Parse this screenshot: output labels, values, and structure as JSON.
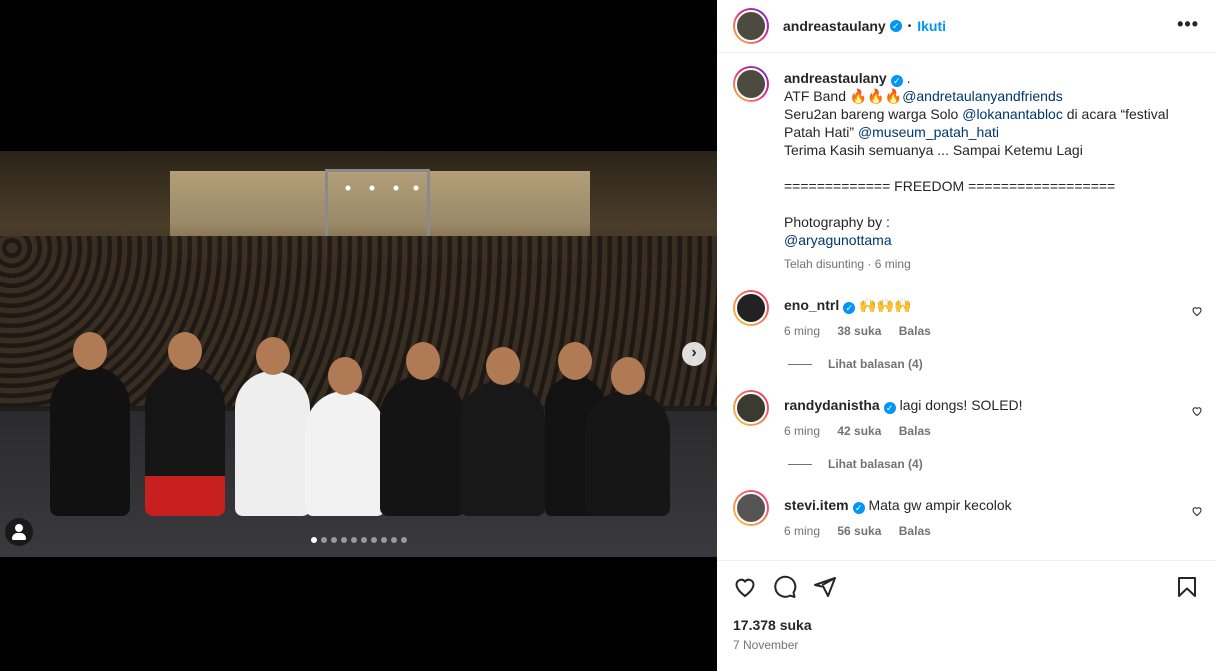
{
  "header": {
    "username": "andreastaulany",
    "separator": "•",
    "follow_label": "Ikuti",
    "more_label": "•••"
  },
  "caption": {
    "username": "andreastaulany",
    "suffix": ".",
    "line1_text": "ATF Band 🔥🔥🔥",
    "line1_link": "@andretaulanyandfriends",
    "line2_text": "Seru2an bareng warga Solo ",
    "line2_link": "@lokanantabloc",
    "line2_after": " di acara “festival",
    "line3_text": "Patah Hati” ",
    "line3_link": "@museum_patah_hati",
    "line4": "Terima Kasih semuanya ... Sampai Ketemu Lagi",
    "line5": "============= FREEDOM ==================",
    "line6": "Photography by :",
    "line7_link": "@aryagunottama",
    "edited": "Telah disunting · 6 ming"
  },
  "comments": [
    {
      "username": "eno_ntrl",
      "text": "🙌🙌🙌",
      "time": "6 ming",
      "likes": "38 suka",
      "reply": "Balas",
      "view_replies": "Lihat balasan (4)"
    },
    {
      "username": "randydanistha",
      "text": "lagi dongs! SOLED!",
      "time": "6 ming",
      "likes": "42 suka",
      "reply": "Balas",
      "view_replies": "Lihat balasan (4)"
    },
    {
      "username": "stevi.item",
      "text": "Mata gw ampir kecolok",
      "time": "6 ming",
      "likes": "56 suka",
      "reply": "Balas"
    }
  ],
  "footer": {
    "likes": "17.378 suka",
    "date": "7 November"
  },
  "carousel": {
    "total": 10,
    "active": 1
  },
  "colors": {
    "link": "#00376b",
    "accent": "#0095f6",
    "muted": "#737373"
  }
}
